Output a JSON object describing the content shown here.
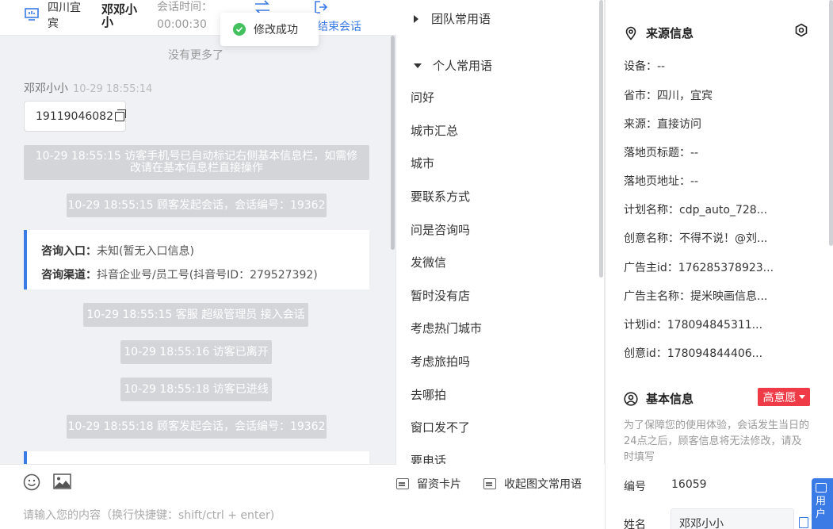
{
  "header": {
    "location": "四川宜宾",
    "name": "邓邓小小",
    "time_label": "会话时间：",
    "time_value": "00:00:30",
    "end_label": "结束会话"
  },
  "toast": {
    "text": "修改成功"
  },
  "chat": {
    "no_more": "没有更多了",
    "sender": "邓邓小小",
    "sender_time": "10-29 18:55:14",
    "phone": "19119046082",
    "sys_msgs": [
      "10-29 18:55:15 访客手机号已自动标记右侧基本信息栏，如需修改请在基本信息栏直接操作",
      "10-29 18:55:15 顾客发起会话，会话编号：19362",
      "10-29 18:55:15 客服 超级管理员 接入会话",
      "10-29 18:55:16 访客已离开",
      "10-29 18:55:18 访客已进线",
      "10-29 18:55:18 顾客发起会话，会话编号：19362"
    ],
    "info_card": {
      "entry_key": "咨询入口：",
      "entry_value": "未知(暂无入口信息)",
      "channel_key": "咨询渠道：",
      "channel_value": "抖音企业号/员工号(抖音号ID：279527392)"
    },
    "input_placeholder": "请输入您的内容（换行快捷键：shift/ctrl + enter)"
  },
  "phrases": {
    "team_group": "团队常用语",
    "personal_group": "个人常用语",
    "items": [
      "问好",
      "城市汇总",
      "城市",
      "要联系方式",
      "问是咨询吗",
      "发微信",
      "暂时没有店",
      "考虑热门城市",
      "考虑旅拍吗",
      "去哪拍",
      "窗口发不了",
      "要电话"
    ],
    "footer_card": "留资卡片",
    "footer_collapse": "收起图文常用语"
  },
  "source": {
    "title": "来源信息",
    "rows": [
      "设备：--",
      "省市：四川，宜宾",
      "来源：直接访问",
      "落地页标题：--",
      "落地页地址：--",
      "计划名称：cdp_auto_728...",
      "创意名称：不得不说！@刘...",
      "广告主id：176285378923...",
      "广告主名称：提米映画信息...",
      "计划id：178094845311...",
      "创意id：178094844406..."
    ]
  },
  "basic": {
    "title": "基本信息",
    "badge": "高意愿",
    "notice": "为了保障您的使用体验，会话发生当日的24点之后，顾客信息将无法修改，请及时填写",
    "id_label": "编号",
    "id_value": "16059",
    "name_label": "姓名",
    "name_value": "邓邓小小"
  },
  "side_tab": {
    "label": "用户"
  },
  "colors": {
    "accent": "#3a7be6",
    "badge": "#ef3b47",
    "success": "#43c15f"
  }
}
